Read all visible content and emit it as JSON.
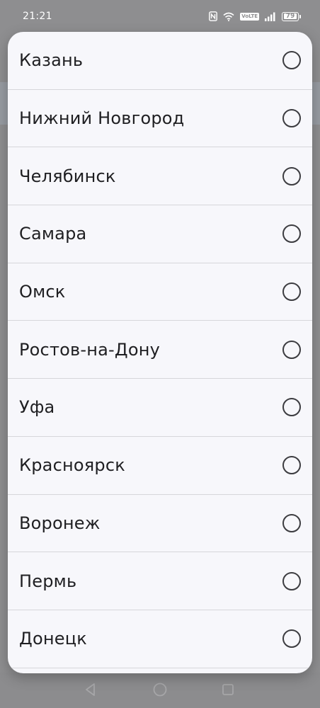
{
  "status_bar": {
    "time": "21:21",
    "volte_label": "VoLTE",
    "battery_level": "79",
    "icons": [
      "nfc-icon",
      "wifi-icon",
      "volte-icon",
      "signal-icon",
      "battery-icon"
    ]
  },
  "colors": {
    "dialog_background": "#f7f7fb",
    "scrim": "#8e8e90",
    "text": "#1f1f22",
    "radio_border": "#3c3c40",
    "divider": "#d6d6da"
  },
  "city_list": {
    "items": [
      {
        "label": "Казань",
        "selected": false
      },
      {
        "label": "Нижний Новгород",
        "selected": false
      },
      {
        "label": "Челябинск",
        "selected": false
      },
      {
        "label": "Самара",
        "selected": false
      },
      {
        "label": "Омск",
        "selected": false
      },
      {
        "label": "Ростов-на-Дону",
        "selected": false
      },
      {
        "label": "Уфа",
        "selected": false
      },
      {
        "label": "Красноярск",
        "selected": false
      },
      {
        "label": "Воронеж",
        "selected": false
      },
      {
        "label": "Пермь",
        "selected": false
      },
      {
        "label": "Донецк",
        "selected": false
      }
    ]
  },
  "navigation_bar": {
    "icons": [
      "back-icon",
      "home-icon",
      "recents-icon"
    ]
  }
}
